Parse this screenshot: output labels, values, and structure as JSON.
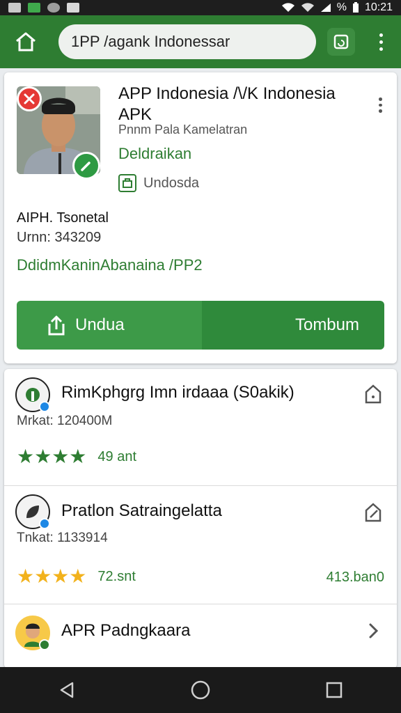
{
  "statusbar": {
    "time": "10:21",
    "battery": "%"
  },
  "toolbar": {
    "url": "1PP /agank Indonessar"
  },
  "app": {
    "title": "APP Indonesia /\\/K Indonesia APK",
    "developer": "Pnnm Pala Kamelatran",
    "status": "Deldraikan",
    "language": "Undosda",
    "publisher": "AIPH. Tsonetal",
    "version": "Urnn: 343209",
    "link": "DdidmKaninAbanaina /PP2",
    "download_label": "Undua",
    "secondary_label": "Tombum"
  },
  "list": [
    {
      "title": "RimKphgrg Imn irdaaa (S0akik)",
      "meta": "Mrkat: 120400M",
      "rating": "49 ant",
      "stars": 4,
      "star_color": "#2e7d32",
      "extra": ""
    },
    {
      "title": "Pratlon Satraingelatta",
      "meta": "Tnkat: 1133914",
      "rating": "72.snt",
      "stars": 4,
      "star_color": "#f2b21c",
      "extra": "413.ban0"
    },
    {
      "title": "APR Padngkaara",
      "meta": "",
      "rating": "",
      "stars": 0,
      "star_color": "",
      "extra": ""
    }
  ],
  "colors": {
    "primary": "#2e7d32",
    "accent_red": "#e53935",
    "star_yellow": "#f2b21c"
  },
  "icons": [
    "home-icon",
    "tab-switcher-icon",
    "more-vert-icon",
    "download-icon",
    "language-icon",
    "share-icon",
    "edit-icon",
    "chevron-right-icon",
    "back-icon",
    "home-nav-icon",
    "recents-icon"
  ]
}
